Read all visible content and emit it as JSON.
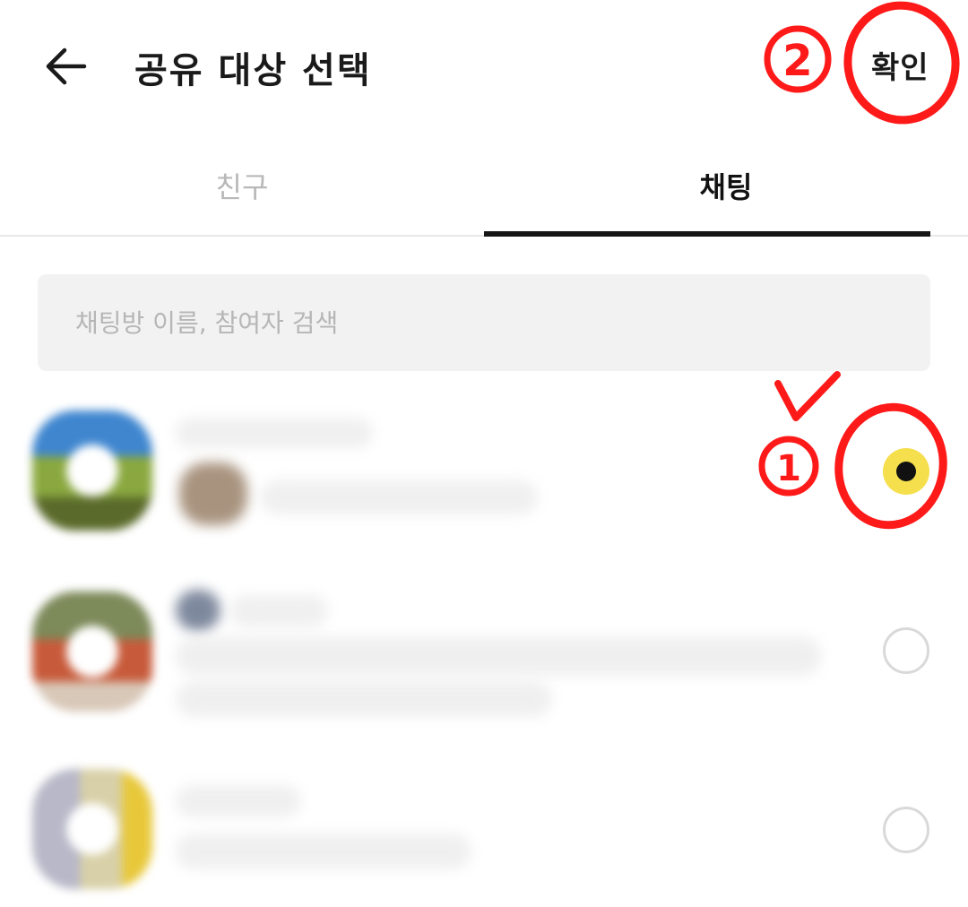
{
  "header": {
    "title": "공유 대상 선택",
    "confirm_label": "확인"
  },
  "tabs": [
    {
      "label": "친구",
      "selected": false
    },
    {
      "label": "채팅",
      "selected": true
    }
  ],
  "search": {
    "placeholder": "채팅방 이름, 참여자 검색",
    "value": ""
  },
  "chat_list": [
    {
      "selected": true
    },
    {
      "selected": false
    },
    {
      "selected": false
    }
  ],
  "annotations": {
    "marker_1": "1",
    "marker_2": "2",
    "check_mark": "✓",
    "color": "#ff1a1a"
  },
  "colors": {
    "selection_yellow": "#f5df4d",
    "tab_underline": "#161616"
  }
}
